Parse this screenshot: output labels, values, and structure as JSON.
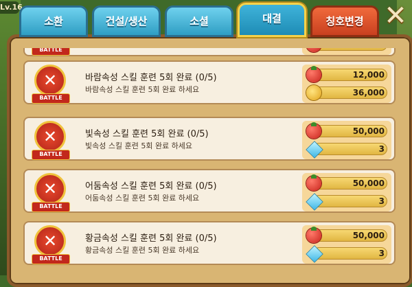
{
  "level_badge": "Lv.16",
  "tabs": [
    {
      "label": "소환",
      "active": false
    },
    {
      "label": "건설/생산",
      "active": false
    },
    {
      "label": "소셜",
      "active": false
    },
    {
      "label": "대결",
      "active": true
    },
    {
      "label": "칭호변경",
      "active": false
    }
  ],
  "close_label": "✕",
  "partial_row": {
    "badge_label": "BATTLE"
  },
  "rows": [
    {
      "badge_label": "BATTLE",
      "title": "바람속성 스킬 훈련 5회 완료 (0/5)",
      "desc": "바람속성 스킬 훈련 5회 완료 하세요",
      "rewards": [
        {
          "icon": "tomato-icon",
          "value": "12,000"
        },
        {
          "icon": "coin-icon",
          "value": "36,000"
        }
      ]
    },
    {
      "badge_label": "BATTLE",
      "title": "빛속성 스킬 훈련 5회 완료 (0/5)",
      "desc": "빛속성 스킬 훈련 5회 완료 하세요",
      "rewards": [
        {
          "icon": "tomato-icon",
          "value": "50,000"
        },
        {
          "icon": "gem-icon",
          "value": "3"
        }
      ]
    },
    {
      "badge_label": "BATTLE",
      "title": "어둠속성 스킬 훈련 5회 완료 (0/5)",
      "desc": "어둠속성 스킬 훈련 5회 완료 하세요",
      "rewards": [
        {
          "icon": "tomato-icon",
          "value": "50,000"
        },
        {
          "icon": "gem-icon",
          "value": "3"
        }
      ]
    },
    {
      "badge_label": "BATTLE",
      "title": "황금속성 스킬 훈련 5회 완료 (0/5)",
      "desc": "황금속성 스킬 훈련 5회 완료 하세요",
      "rewards": [
        {
          "icon": "tomato-icon",
          "value": "50,000"
        },
        {
          "icon": "gem-icon",
          "value": "3"
        }
      ]
    }
  ]
}
